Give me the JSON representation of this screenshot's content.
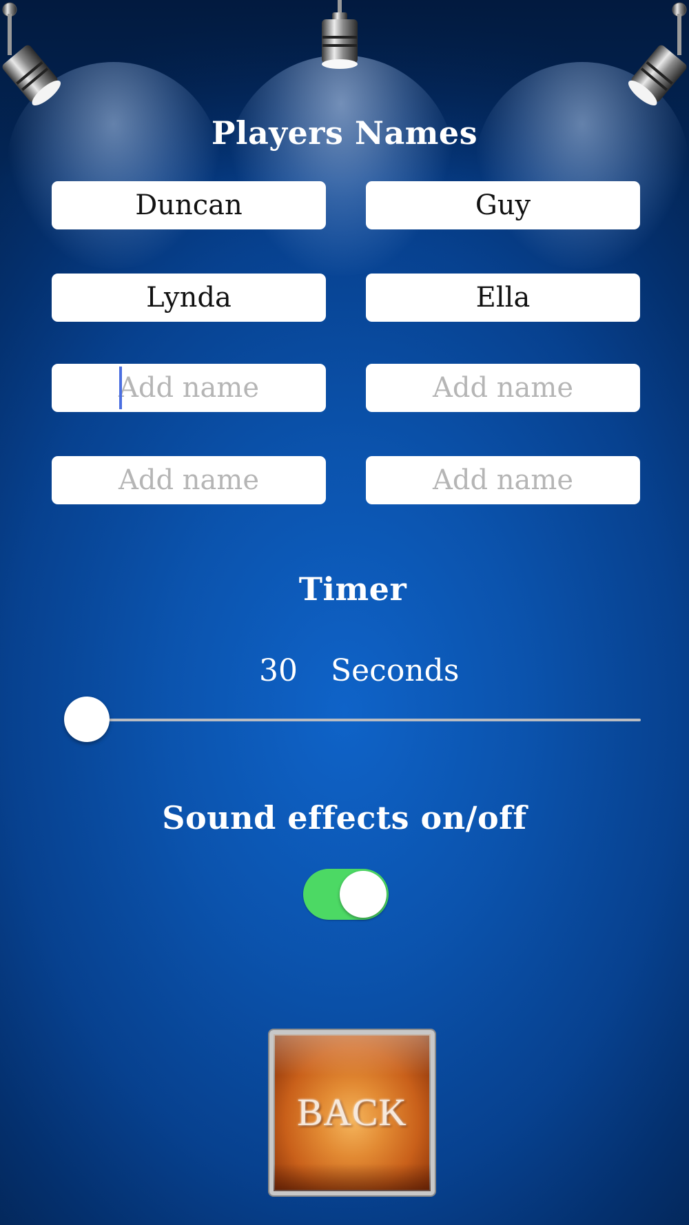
{
  "players": {
    "title": "Players Names",
    "placeholder": "Add name",
    "names": [
      "Duncan",
      "Guy",
      "Lynda",
      "Ella",
      "",
      "",
      "",
      ""
    ]
  },
  "timer": {
    "title": "Timer",
    "value": "30",
    "unit": "Seconds",
    "slider_fraction": 0.0
  },
  "sound": {
    "title": "Sound effects on/off",
    "enabled": true
  },
  "back_button": {
    "label": "BACK"
  },
  "icons": {
    "lamps": [
      "spotlight-icon",
      "spotlight-icon",
      "spotlight-icon"
    ]
  },
  "colors": {
    "toggle_on": "#4cd964",
    "background": "#0b53ad",
    "back_button": "#c9601a"
  }
}
